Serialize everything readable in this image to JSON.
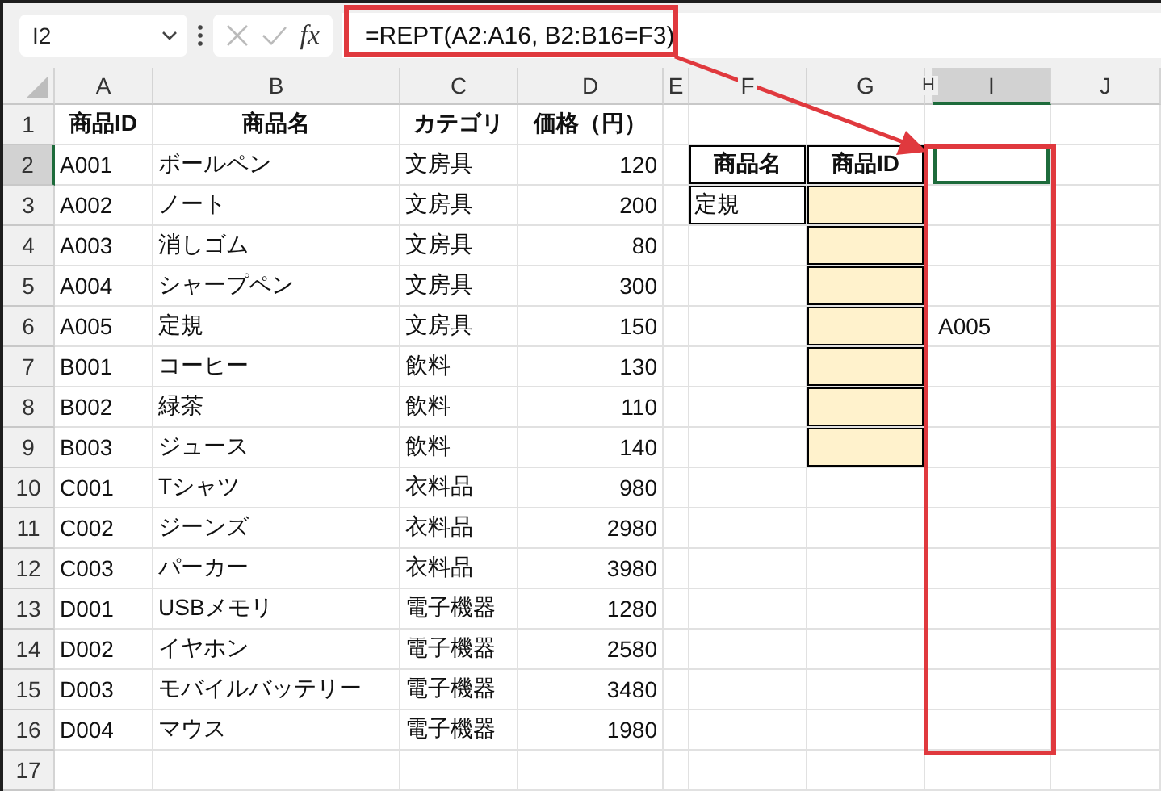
{
  "formula_bar": {
    "name_box": "I2",
    "function_label": "fx",
    "formula": "=REPT(A2:A16, B2:B16=F3)"
  },
  "columns": [
    {
      "label": "A",
      "selected": false
    },
    {
      "label": "B",
      "selected": false
    },
    {
      "label": "C",
      "selected": false
    },
    {
      "label": "D",
      "selected": false
    },
    {
      "label": "E",
      "selected": false
    },
    {
      "label": "F",
      "selected": false
    },
    {
      "label": "G",
      "selected": false
    },
    {
      "label": "H",
      "selected": false
    },
    {
      "label": "I",
      "selected": true
    },
    {
      "label": "J",
      "selected": false
    }
  ],
  "rows": [
    {
      "number": "1",
      "selected": false,
      "cells": {
        "A": {
          "text": "商品ID",
          "kind": "column-title"
        },
        "B": {
          "text": "商品名",
          "kind": "column-title"
        },
        "C": {
          "text": "カテゴリ",
          "kind": "column-title"
        },
        "D": {
          "text": "価格（円）",
          "kind": "column-title"
        }
      }
    },
    {
      "number": "2",
      "selected": true,
      "cells": {
        "A": {
          "text": "A001",
          "kind": "plain"
        },
        "B": {
          "text": "ボールペン",
          "kind": "plain"
        },
        "C": {
          "text": "文房具",
          "kind": "plain"
        },
        "D": {
          "text": "120",
          "kind": "plain"
        },
        "F": {
          "text": "商品名",
          "kind": "lookup-header"
        },
        "G": {
          "text": "商品ID",
          "kind": "lookup-header"
        },
        "I": {
          "selected": true
        }
      }
    },
    {
      "number": "3",
      "selected": false,
      "cells": {
        "A": {
          "text": "A002",
          "kind": "plain"
        },
        "B": {
          "text": "ノート",
          "kind": "plain"
        },
        "C": {
          "text": "文房具",
          "kind": "plain"
        },
        "D": {
          "text": "200",
          "kind": "plain"
        },
        "F": {
          "text": "定規",
          "kind": "lookup-input"
        },
        "G": {
          "kind": "lookup-result"
        }
      }
    },
    {
      "number": "4",
      "selected": false,
      "cells": {
        "A": {
          "text": "A003",
          "kind": "plain"
        },
        "B": {
          "text": "消しゴム",
          "kind": "plain"
        },
        "C": {
          "text": "文房具",
          "kind": "plain"
        },
        "D": {
          "text": "80",
          "kind": "plain"
        },
        "G": {
          "kind": "lookup-result"
        }
      }
    },
    {
      "number": "5",
      "selected": false,
      "cells": {
        "A": {
          "text": "A004",
          "kind": "plain"
        },
        "B": {
          "text": "シャープペン",
          "kind": "plain"
        },
        "C": {
          "text": "文房具",
          "kind": "plain"
        },
        "D": {
          "text": "300",
          "kind": "plain"
        },
        "G": {
          "kind": "lookup-result"
        }
      }
    },
    {
      "number": "6",
      "selected": false,
      "cells": {
        "A": {
          "text": "A005",
          "kind": "plain"
        },
        "B": {
          "text": "定規",
          "kind": "plain"
        },
        "C": {
          "text": "文房具",
          "kind": "plain"
        },
        "D": {
          "text": "150",
          "kind": "plain"
        },
        "G": {
          "kind": "lookup-result"
        },
        "I": {
          "text": "A005"
        }
      }
    },
    {
      "number": "7",
      "selected": false,
      "cells": {
        "A": {
          "text": "B001",
          "kind": "plain"
        },
        "B": {
          "text": "コーヒー",
          "kind": "plain"
        },
        "C": {
          "text": "飲料",
          "kind": "plain"
        },
        "D": {
          "text": "130",
          "kind": "plain"
        },
        "G": {
          "kind": "lookup-result"
        }
      }
    },
    {
      "number": "8",
      "selected": false,
      "cells": {
        "A": {
          "text": "B002",
          "kind": "plain"
        },
        "B": {
          "text": "緑茶",
          "kind": "plain"
        },
        "C": {
          "text": "飲料",
          "kind": "plain"
        },
        "D": {
          "text": "110",
          "kind": "plain"
        },
        "G": {
          "kind": "lookup-result"
        }
      }
    },
    {
      "number": "9",
      "selected": false,
      "cells": {
        "A": {
          "text": "B003",
          "kind": "plain"
        },
        "B": {
          "text": "ジュース",
          "kind": "plain"
        },
        "C": {
          "text": "飲料",
          "kind": "plain"
        },
        "D": {
          "text": "140",
          "kind": "plain"
        },
        "G": {
          "kind": "lookup-result"
        }
      }
    },
    {
      "number": "10",
      "selected": false,
      "cells": {
        "A": {
          "text": "C001",
          "kind": "plain"
        },
        "B": {
          "text": "Tシャツ",
          "kind": "plain"
        },
        "C": {
          "text": "衣料品",
          "kind": "plain"
        },
        "D": {
          "text": "980",
          "kind": "plain"
        }
      }
    },
    {
      "number": "11",
      "selected": false,
      "cells": {
        "A": {
          "text": "C002",
          "kind": "plain"
        },
        "B": {
          "text": "ジーンズ",
          "kind": "plain"
        },
        "C": {
          "text": "衣料品",
          "kind": "plain"
        },
        "D": {
          "text": "2980",
          "kind": "plain"
        }
      }
    },
    {
      "number": "12",
      "selected": false,
      "cells": {
        "A": {
          "text": "C003",
          "kind": "plain"
        },
        "B": {
          "text": "パーカー",
          "kind": "plain"
        },
        "C": {
          "text": "衣料品",
          "kind": "plain"
        },
        "D": {
          "text": "3980",
          "kind": "plain"
        }
      }
    },
    {
      "number": "13",
      "selected": false,
      "cells": {
        "A": {
          "text": "D001",
          "kind": "plain"
        },
        "B": {
          "text": "USBメモリ",
          "kind": "plain"
        },
        "C": {
          "text": "電子機器",
          "kind": "plain"
        },
        "D": {
          "text": "1280",
          "kind": "plain"
        }
      }
    },
    {
      "number": "14",
      "selected": false,
      "cells": {
        "A": {
          "text": "D002",
          "kind": "plain"
        },
        "B": {
          "text": "イヤホン",
          "kind": "plain"
        },
        "C": {
          "text": "電子機器",
          "kind": "plain"
        },
        "D": {
          "text": "2580",
          "kind": "plain"
        }
      }
    },
    {
      "number": "15",
      "selected": false,
      "cells": {
        "A": {
          "text": "D003",
          "kind": "plain"
        },
        "B": {
          "text": "モバイルバッテリー",
          "kind": "plain"
        },
        "C": {
          "text": "電子機器",
          "kind": "plain"
        },
        "D": {
          "text": "3480",
          "kind": "plain"
        }
      }
    },
    {
      "number": "16",
      "selected": false,
      "cells": {
        "A": {
          "text": "D004",
          "kind": "plain"
        },
        "B": {
          "text": "マウス",
          "kind": "plain"
        },
        "C": {
          "text": "電子機器",
          "kind": "plain"
        },
        "D": {
          "text": "1980",
          "kind": "plain"
        }
      }
    },
    {
      "number": "17",
      "selected": false,
      "cells": {}
    }
  ]
}
